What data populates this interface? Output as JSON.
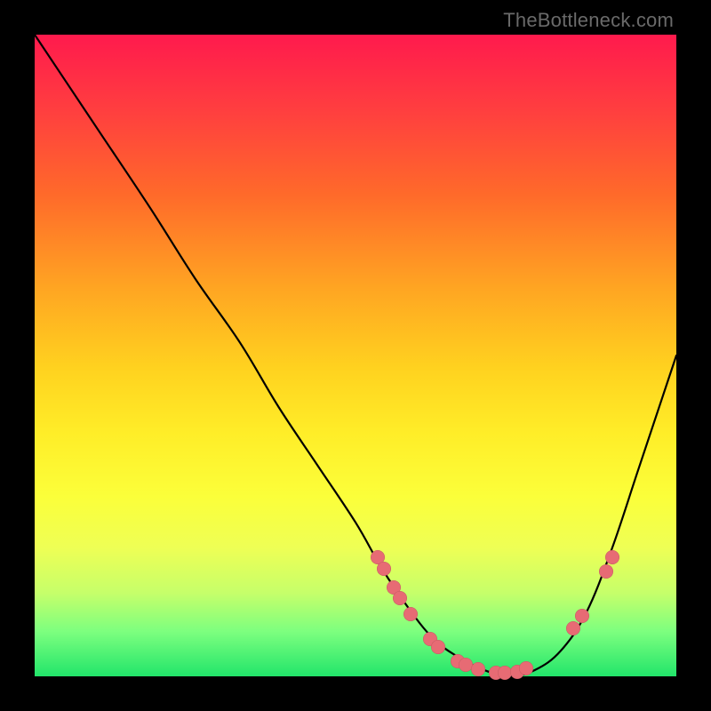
{
  "watermark": "TheBottleneck.com",
  "chart_data": {
    "type": "line",
    "title": "",
    "xlabel": "",
    "ylabel": "",
    "xlim": [
      0,
      100
    ],
    "ylim": [
      0,
      100
    ],
    "grid": false,
    "legend": false,
    "series": [
      {
        "name": "curve",
        "x": [
          0,
          4,
          10,
          18,
          25,
          32,
          38,
          44,
          50,
          54,
          58,
          62,
          66,
          70,
          74,
          78,
          82,
          86,
          90,
          94,
          98,
          100
        ],
        "y": [
          100,
          94,
          85,
          73,
          62,
          52,
          42,
          33,
          24,
          17,
          11,
          6,
          3,
          1,
          0,
          1,
          4,
          10,
          20,
          32,
          44,
          50
        ]
      }
    ],
    "points": [
      {
        "x": 53.5,
        "y": 18.6
      },
      {
        "x": 54.4,
        "y": 16.8
      },
      {
        "x": 56.0,
        "y": 13.8
      },
      {
        "x": 56.9,
        "y": 12.2
      },
      {
        "x": 58.6,
        "y": 9.7
      },
      {
        "x": 61.6,
        "y": 5.8
      },
      {
        "x": 62.9,
        "y": 4.6
      },
      {
        "x": 65.9,
        "y": 2.4
      },
      {
        "x": 67.2,
        "y": 1.8
      },
      {
        "x": 69.1,
        "y": 1.1
      },
      {
        "x": 71.9,
        "y": 0.5
      },
      {
        "x": 73.3,
        "y": 0.5
      },
      {
        "x": 75.2,
        "y": 0.7
      },
      {
        "x": 76.6,
        "y": 1.2
      },
      {
        "x": 83.9,
        "y": 7.5
      },
      {
        "x": 85.3,
        "y": 9.4
      },
      {
        "x": 89.0,
        "y": 16.3
      },
      {
        "x": 90.0,
        "y": 18.6
      }
    ],
    "gradient_stops": [
      {
        "pct": 0,
        "color": "#ff1a4d"
      },
      {
        "pct": 12,
        "color": "#ff3f3f"
      },
      {
        "pct": 25,
        "color": "#ff6a2a"
      },
      {
        "pct": 40,
        "color": "#ffa722"
      },
      {
        "pct": 52,
        "color": "#ffd21f"
      },
      {
        "pct": 62,
        "color": "#ffed28"
      },
      {
        "pct": 72,
        "color": "#fbff3a"
      },
      {
        "pct": 80,
        "color": "#eeff55"
      },
      {
        "pct": 87,
        "color": "#c6ff6a"
      },
      {
        "pct": 93,
        "color": "#7dff7f"
      },
      {
        "pct": 100,
        "color": "#22e56a"
      }
    ]
  }
}
